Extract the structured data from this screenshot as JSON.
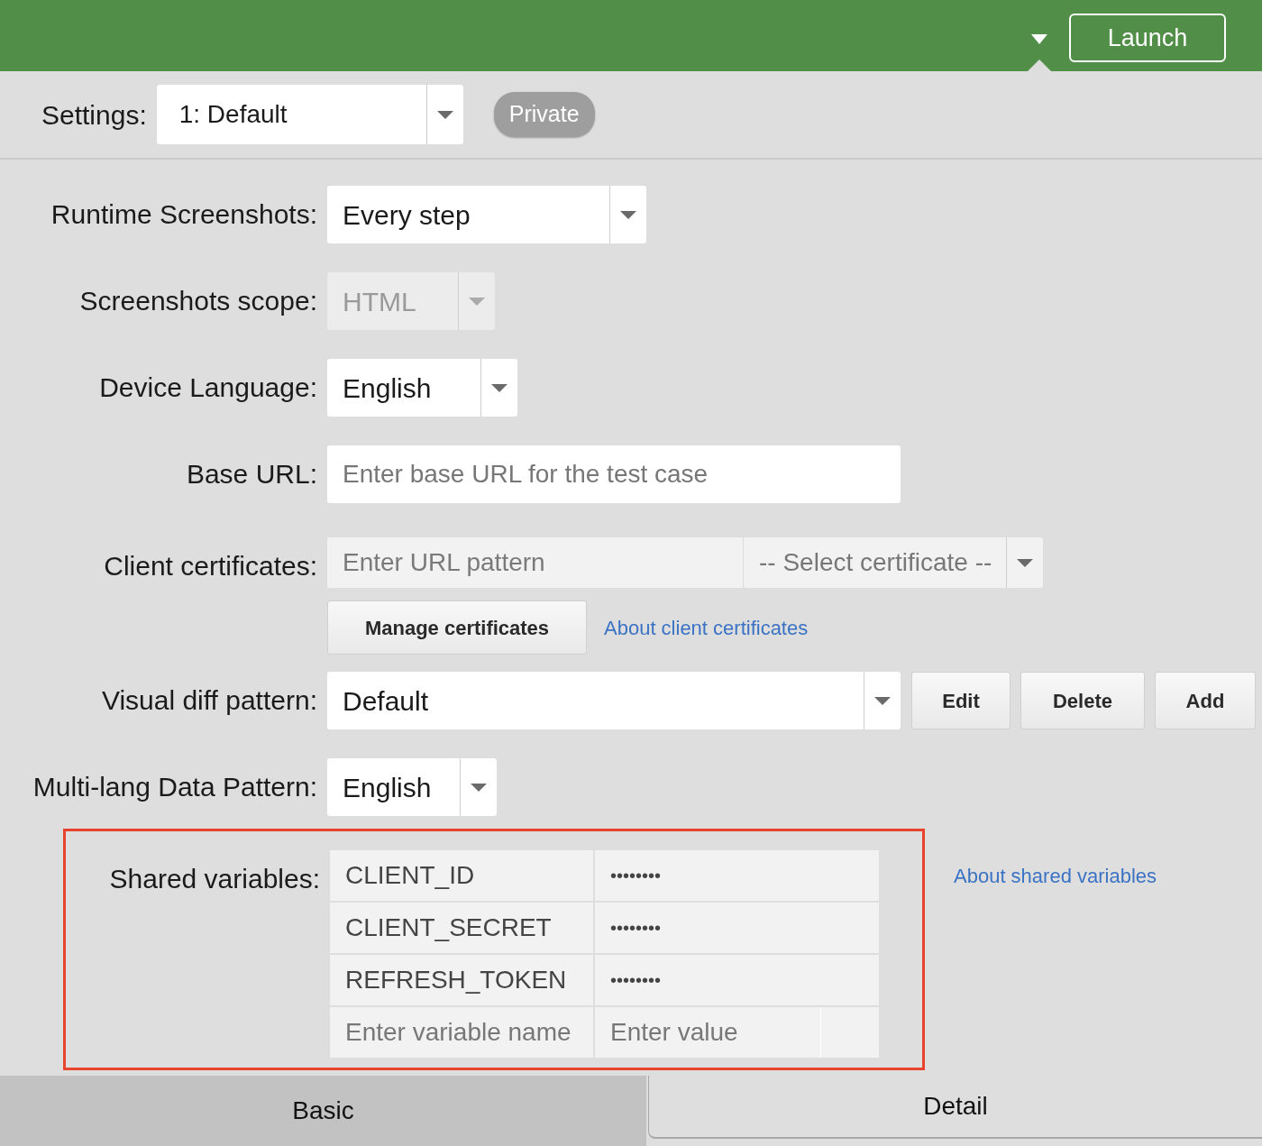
{
  "header": {
    "launch_button": "Launch"
  },
  "settings": {
    "label": "Settings:",
    "value": "1: Default",
    "badge": "Private"
  },
  "fields": [
    {
      "kind": "select",
      "label": "Runtime Screenshots:",
      "value": "Every step",
      "disabled": false
    },
    {
      "kind": "select",
      "label": "Screenshots scope:",
      "value": "HTML",
      "disabled": true
    },
    {
      "kind": "select",
      "label": "Device Language:",
      "value": "English",
      "disabled": false
    },
    {
      "kind": "input",
      "label": "Base URL:",
      "placeholder": "Enter base URL for the test case"
    },
    {
      "kind": "certificates",
      "label": "Client certificates:",
      "url_placeholder": "Enter URL pattern",
      "certificate": "-- Select certificate --",
      "button": "Manage certificates",
      "link": "About client certificates"
    },
    {
      "kind": "pattern",
      "label": "Visual diff pattern:",
      "value": "Default",
      "buttons": [
        "Edit",
        "Delete",
        "Add"
      ]
    },
    {
      "kind": "select",
      "label": "Multi-lang Data Pattern:",
      "value": "English",
      "disabled": false
    }
  ],
  "shared_variables": {
    "label": "Shared variables:",
    "highlighted": true,
    "rows": [
      {
        "name": "CLIENT_ID",
        "value": "••••••••"
      },
      {
        "name": "CLIENT_SECRET",
        "value": "••••••••"
      },
      {
        "name": "REFRESH_TOKEN",
        "value": "••••••••"
      }
    ],
    "name_placeholder": "Enter variable name",
    "value_placeholder": "Enter value",
    "link": "About shared variables"
  },
  "tabs": [
    {
      "label": "Basic",
      "selected": true
    },
    {
      "label": "Detail",
      "selected": false
    }
  ]
}
